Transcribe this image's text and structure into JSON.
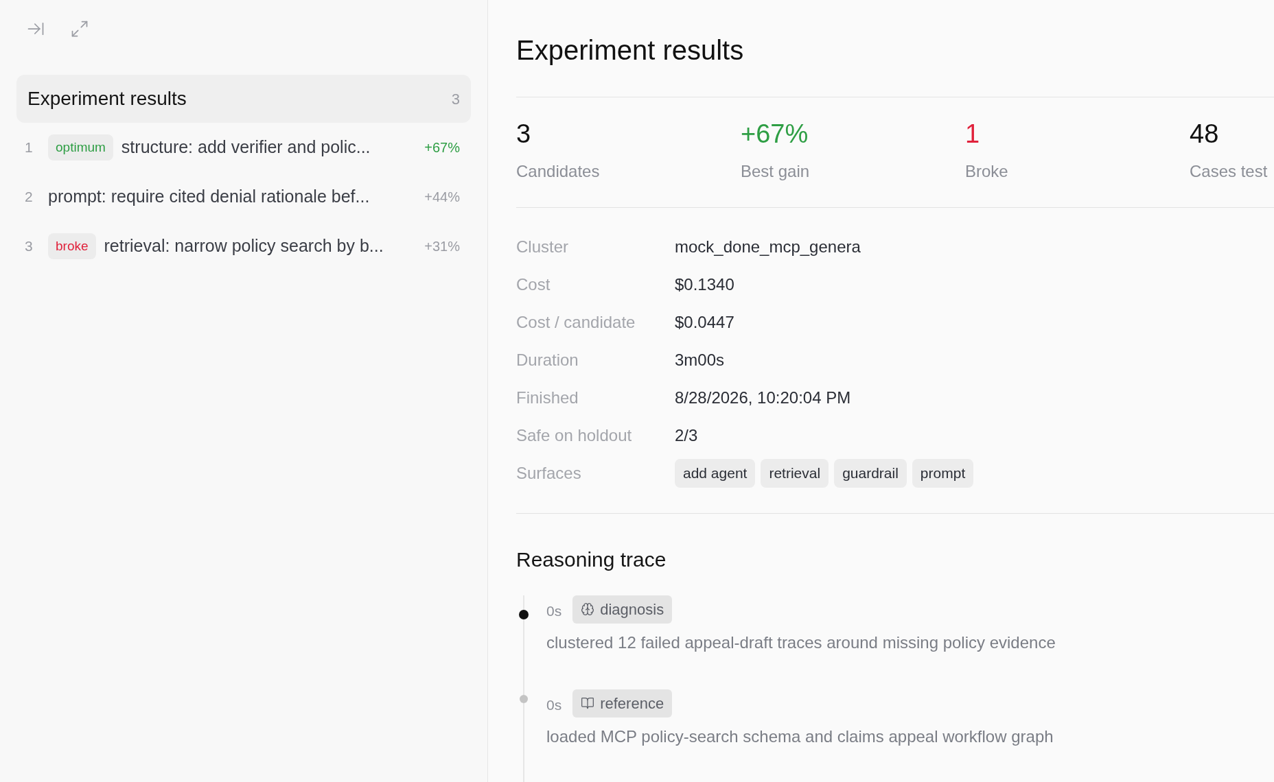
{
  "sidebar": {
    "header": {
      "title": "Experiment results",
      "count": "3"
    },
    "items": [
      {
        "index": "1",
        "tag": {
          "label": "optimum",
          "kind": "optimum"
        },
        "title": "structure: add verifier and polic...",
        "gain": "+67%"
      },
      {
        "index": "2",
        "title": "prompt: require cited denial rationale bef...",
        "gain": "+44%"
      },
      {
        "index": "3",
        "tag": {
          "label": "broke",
          "kind": "broke"
        },
        "title": "retrieval: narrow policy search by b...",
        "gain": "+31%"
      }
    ]
  },
  "main": {
    "title": "Experiment results",
    "stats": [
      {
        "value": "3",
        "label": "Candidates",
        "kind": "neutral"
      },
      {
        "value": "+67%",
        "label": "Best gain",
        "kind": "positive"
      },
      {
        "value": "1",
        "label": "Broke",
        "kind": "negative"
      },
      {
        "value": "48",
        "label": "Cases test",
        "kind": "neutral"
      }
    ],
    "details": [
      {
        "label": "Cluster",
        "value": "mock_done_mcp_genera",
        "kind": "text"
      },
      {
        "label": "Cost",
        "value": "$0.1340",
        "kind": "text"
      },
      {
        "label": "Cost / candidate",
        "value": "$0.0447",
        "kind": "text"
      },
      {
        "label": "Duration",
        "value": "3m00s",
        "kind": "text"
      },
      {
        "label": "Finished",
        "value": "8/28/2026, 10:20:04 PM",
        "kind": "text"
      },
      {
        "label": "Safe on holdout",
        "value": "2/3",
        "kind": "text"
      },
      {
        "label": "Surfaces",
        "tags": [
          "add agent",
          "retrieval",
          "guardrail",
          "prompt"
        ],
        "kind": "tags"
      }
    ],
    "trace": {
      "title": "Reasoning trace",
      "steps": [
        {
          "time": "0s",
          "kind": "diagnosis",
          "label": "diagnosis",
          "text": "clustered 12 failed appeal-draft traces around missing policy evidence",
          "active": true
        },
        {
          "time": "0s",
          "kind": "reference",
          "label": "reference",
          "text": "loaded MCP policy-search schema and claims appeal workflow graph",
          "active": false
        }
      ]
    }
  }
}
